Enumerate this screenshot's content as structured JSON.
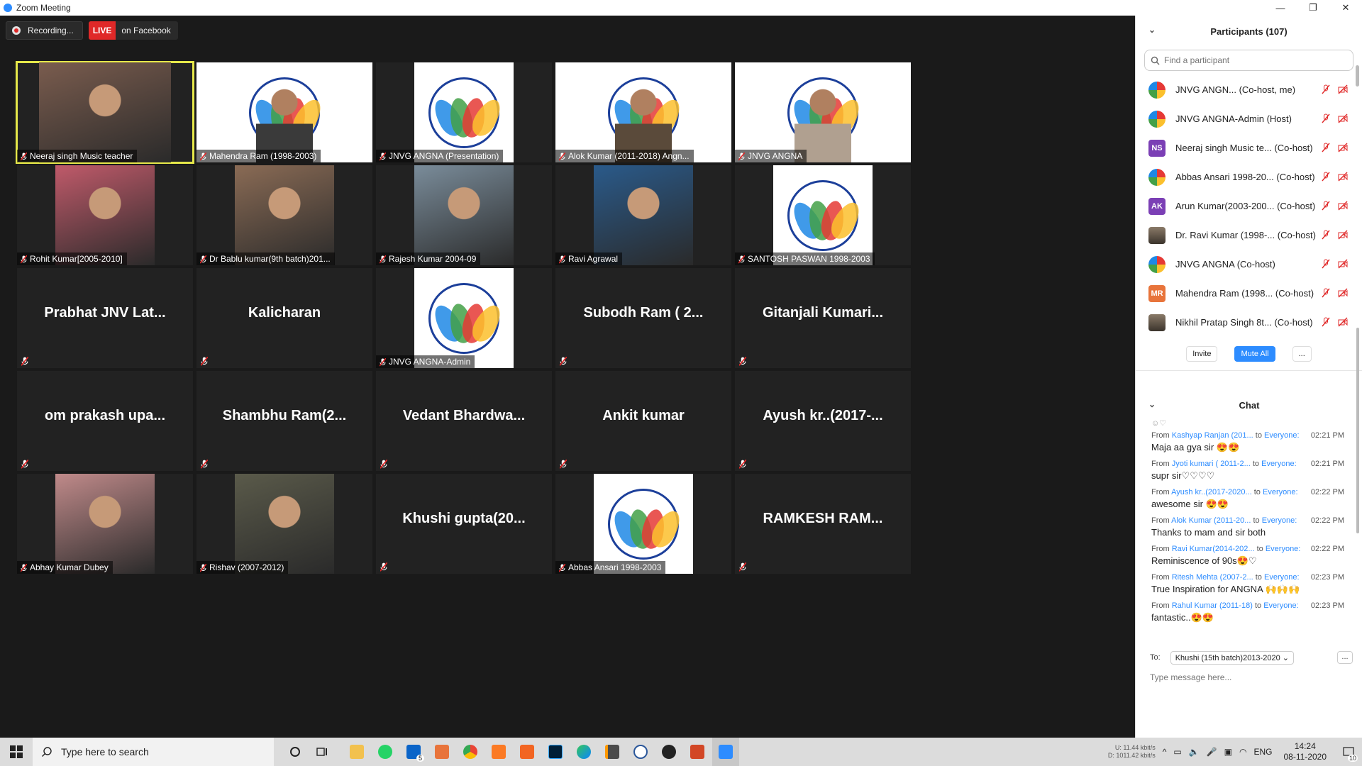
{
  "window": {
    "title": "Zoom Meeting"
  },
  "recording": {
    "label": "Recording...",
    "live_badge": "LIVE",
    "live_target": "on Facebook"
  },
  "tiles": [
    {
      "name": "Neeraj singh Music teacher",
      "kind": "video",
      "active": true,
      "bg": "#7a5c4e"
    },
    {
      "name": "Mahendra Ram (1998-2003)",
      "kind": "logo-video",
      "bg": "#3a3a3a"
    },
    {
      "name": "JNVG ANGNA (Presentation)",
      "kind": "logo"
    },
    {
      "name": "Alok Kumar (2011-2018) Angn...",
      "kind": "logo-video",
      "bg": "#5a4a3a"
    },
    {
      "name": "JNVG ANGNA",
      "kind": "logo-video",
      "bg": "#b0a090"
    },
    {
      "name": "Rohit Kumar[2005-2010]",
      "kind": "video",
      "bg": "#c05a6a"
    },
    {
      "name": "Dr Bablu kumar(9th batch)201...",
      "kind": "video",
      "bg": "#8a6b55"
    },
    {
      "name": "Rajesh Kumar 2004-09",
      "kind": "video",
      "bg": "#7a8c9a"
    },
    {
      "name": "Ravi Agrawal",
      "kind": "video",
      "bg": "#2a5a8a"
    },
    {
      "name": "SANTOSH PASWAN 1998-2003",
      "kind": "logo"
    },
    {
      "name": "Prabhat JNV Lat...",
      "kind": "text"
    },
    {
      "name": "Kalicharan",
      "kind": "text"
    },
    {
      "name": "JNVG ANGNA-Admin",
      "kind": "logo"
    },
    {
      "name": "Subodh Ram ( 2...",
      "kind": "text"
    },
    {
      "name": "Gitanjali Kumari...",
      "kind": "text"
    },
    {
      "name": "om prakash upa...",
      "kind": "text"
    },
    {
      "name": "Shambhu Ram(2...",
      "kind": "text"
    },
    {
      "name": "Vedant Bhardwa...",
      "kind": "text"
    },
    {
      "name": "Ankit kumar",
      "kind": "text"
    },
    {
      "name": "Ayush kr..(2017-...",
      "kind": "text"
    },
    {
      "name": "Abhay Kumar Dubey",
      "kind": "video",
      "bg": "#c08a8a"
    },
    {
      "name": "Rishav (2007-2012)",
      "kind": "video",
      "bg": "#5a5a4a"
    },
    {
      "name": "Khushi gupta(20...",
      "kind": "text"
    },
    {
      "name": "Abbas Ansari 1998-2003",
      "kind": "logo"
    },
    {
      "name": "RAMKESH RAM...",
      "kind": "text"
    }
  ],
  "participants": {
    "title": "Participants (107)",
    "search_placeholder": "Find a participant",
    "rows": [
      {
        "name": "JNVG ANGN...  (Co-host, me)",
        "avatar": "logo",
        "initials": "",
        "color": ""
      },
      {
        "name": "JNVG ANGNA-Admin (Host)",
        "avatar": "logo",
        "initials": "",
        "color": ""
      },
      {
        "name": "Neeraj singh Music te...  (Co-host)",
        "avatar": "initials",
        "initials": "NS",
        "color": "#7b3fb5"
      },
      {
        "name": "Abbas Ansari 1998-20...  (Co-host)",
        "avatar": "logo",
        "initials": "",
        "color": ""
      },
      {
        "name": "Arun Kumar(2003-200...  (Co-host)",
        "avatar": "initials",
        "initials": "AK",
        "color": "#7b3fb5"
      },
      {
        "name": "Dr. Ravi Kumar (1998-...  (Co-host)",
        "avatar": "photo",
        "initials": "",
        "color": ""
      },
      {
        "name": "JNVG ANGNA (Co-host)",
        "avatar": "logo",
        "initials": "",
        "color": ""
      },
      {
        "name": "Mahendra Ram (1998...  (Co-host)",
        "avatar": "initials",
        "initials": "MR",
        "color": "#e8743b"
      },
      {
        "name": "Nikhil Pratap Singh 8t...  (Co-host)",
        "avatar": "photo",
        "initials": "",
        "color": ""
      }
    ],
    "invite_label": "Invite",
    "mute_all_label": "Mute All",
    "more_label": "..."
  },
  "chat": {
    "title": "Chat",
    "messages": [
      {
        "from": "Kashyap Ranjan (201...",
        "to": "Everyone:",
        "time": "02:21 PM",
        "text": "Maja aa gya sir 😍😍"
      },
      {
        "from": "Jyoti kumari ( 2011-2...",
        "to": "Everyone:",
        "time": "02:21 PM",
        "text": "supr sir♡♡♡♡"
      },
      {
        "from": "Ayush kr..(2017-2020...",
        "to": "Everyone:",
        "time": "02:22 PM",
        "text": "awesome sir 😍😍"
      },
      {
        "from": "Alok Kumar (2011-20...",
        "to": "Everyone:",
        "time": "02:22 PM",
        "text": "Thanks to mam and sir both"
      },
      {
        "from": "Ravi Kumar(2014-202...",
        "to": "Everyone:",
        "time": "02:22 PM",
        "text": "Reminiscence of 90s😍♡"
      },
      {
        "from": "Ritesh Mehta (2007-2...",
        "to": "Everyone:",
        "time": "02:23 PM",
        "text": "True Inspiration for ANGNA 🙌🙌🙌"
      },
      {
        "from": "Rahul Kumar (2011-18)",
        "to": "Everyone:",
        "time": "02:23 PM",
        "text": "fantastic..😍😍"
      }
    ],
    "from_prefix": "From",
    "to_prefix": "to",
    "to_label": "To:",
    "recipient": "Khushi (15th batch)2013-2020",
    "input_placeholder": "Type message here...",
    "more_label": "..."
  },
  "taskbar": {
    "search_placeholder": "Type here to search",
    "net_up": "U:      11.44 kbit/s",
    "net_down": "D:  1011.42 kbit/s",
    "lang": "ENG",
    "time": "14:24",
    "date": "08-11-2020",
    "notif_count": "10",
    "mail_badge": "5"
  },
  "colors": {
    "accent": "#2d8cff",
    "live": "#e02828",
    "active_border": "#e6e84a",
    "muted_icon": "#e02828"
  }
}
